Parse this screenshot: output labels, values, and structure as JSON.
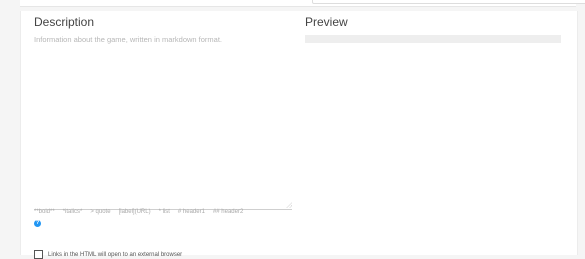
{
  "description": {
    "heading": "Description",
    "placeholder": "Information about the game, written in markdown format.",
    "hints": [
      "**bold**",
      "*italics*",
      "> quote",
      "[label](URL)",
      "* list",
      "# header1",
      "## header2"
    ]
  },
  "preview": {
    "heading": "Preview"
  },
  "links_option": {
    "label": "Links in the HTML will open to an external browser",
    "checked": false
  },
  "colors": {
    "accent": "#2196f3",
    "heading": "#444444",
    "placeholder": "#b7b7b7"
  },
  "icons": {
    "help": "question-circle"
  }
}
